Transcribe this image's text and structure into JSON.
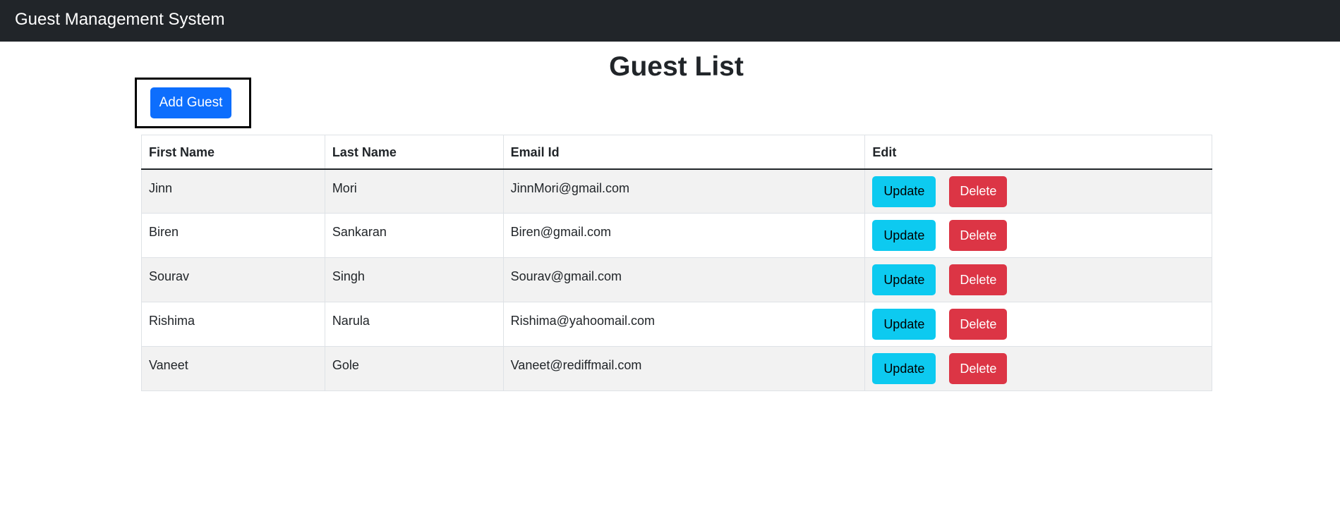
{
  "navbar": {
    "brand": "Guest Management System"
  },
  "page": {
    "title": "Guest List",
    "add_button_label": "Add Guest"
  },
  "table": {
    "headers": [
      "First Name",
      "Last Name",
      "Email Id",
      "Edit"
    ],
    "rows": [
      {
        "first_name": "Jinn",
        "last_name": "Mori",
        "email": "JinnMori@gmail.com"
      },
      {
        "first_name": "Biren",
        "last_name": "Sankaran",
        "email": "Biren@gmail.com"
      },
      {
        "first_name": "Sourav",
        "last_name": "Singh",
        "email": "Sourav@gmail.com"
      },
      {
        "first_name": "Rishima",
        "last_name": "Narula",
        "email": "Rishima@yahoomail.com"
      },
      {
        "first_name": "Vaneet",
        "last_name": "Gole",
        "email": "Vaneet@rediffmail.com"
      }
    ],
    "update_label": "Update",
    "delete_label": "Delete"
  },
  "colors": {
    "navbar": "#212529",
    "primary": "#0d6efd",
    "info": "#0dcaf0",
    "danger": "#dc3545",
    "stripe": "#f2f2f2"
  }
}
